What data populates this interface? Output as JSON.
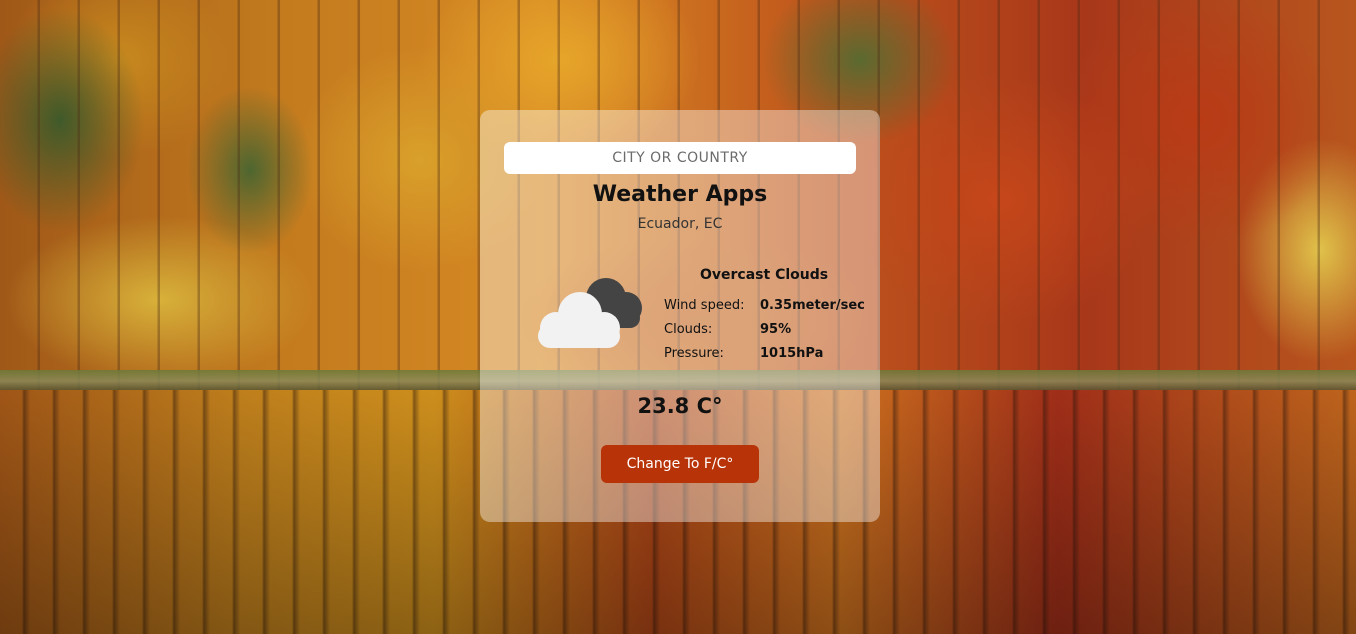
{
  "search": {
    "placeholder": "CITY OR COUNTRY",
    "value": ""
  },
  "app": {
    "title": "Weather Apps"
  },
  "location": "Ecuador, EC",
  "weather": {
    "description": "Overcast Clouds",
    "icon": "overcast-clouds-icon",
    "details": [
      {
        "label": "Wind speed:",
        "value": "0.35meter/sec"
      },
      {
        "label": "Clouds:",
        "value": "95%"
      },
      {
        "label": "Pressure:",
        "value": "1015hPa"
      }
    ],
    "temperature": "23.8 C°"
  },
  "actions": {
    "toggle_unit_label": "Change To F/C°"
  },
  "colors": {
    "button_bg": "#b83308",
    "card_bg": "rgba(255,255,255,0.40)",
    "cloud_front": "#f2f2f2",
    "cloud_back": "#444444"
  }
}
